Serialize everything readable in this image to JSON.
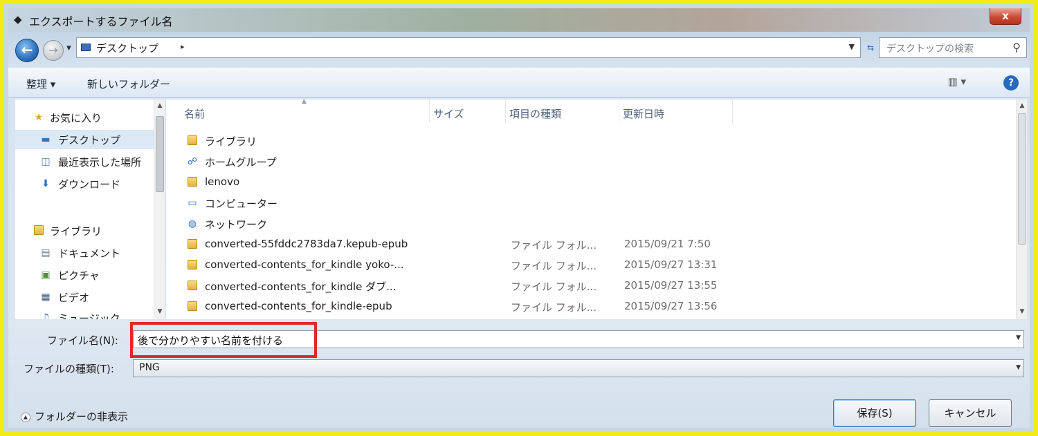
{
  "window": {
    "title": "エクスポートするファイル名",
    "close_label": "x"
  },
  "address": {
    "path": "デスクトップ",
    "separator": "▸",
    "search_placeholder": "デスクトップの検索"
  },
  "toolbar": {
    "organize_label": "整理 ▾",
    "new_folder_label": "新しいフォルダー",
    "view_label": "▥ ▾",
    "help_label": "?"
  },
  "sidebar": {
    "items": [
      {
        "label": "お気に入り",
        "icon": "star-icon"
      },
      {
        "label": "デスクトップ",
        "icon": "desktop-icon"
      },
      {
        "label": "最近表示した場所",
        "icon": "recent-places-icon"
      },
      {
        "label": "ダウンロード",
        "icon": "download-icon"
      },
      {
        "label": "ライブラリ",
        "icon": "library-icon"
      },
      {
        "label": "ドキュメント",
        "icon": "document-icon"
      },
      {
        "label": "ピクチャ",
        "icon": "picture-icon"
      },
      {
        "label": "ビデオ",
        "icon": "video-icon"
      },
      {
        "label": "ミュージック",
        "icon": "music-icon"
      }
    ]
  },
  "columns": {
    "name": "名前",
    "size": "サイズ",
    "type": "項目の種類",
    "date": "更新日時"
  },
  "files": [
    {
      "name": "ライブラリ",
      "type": "",
      "date": "",
      "icon": "library-icon"
    },
    {
      "name": "ホームグループ",
      "type": "",
      "date": "",
      "icon": "homegroup-icon"
    },
    {
      "name": "lenovo",
      "type": "",
      "date": "",
      "icon": "user-folder-icon"
    },
    {
      "name": "コンピューター",
      "type": "",
      "date": "",
      "icon": "computer-icon"
    },
    {
      "name": "ネットワーク",
      "type": "",
      "date": "",
      "icon": "network-icon"
    },
    {
      "name": "converted-55fddc2783da7.kepub-epub",
      "type": "ファイル フォル...",
      "date": "2015/09/21 7:50",
      "icon": "folder-icon"
    },
    {
      "name": "converted-contents_for_kindle yoko-...",
      "type": "ファイル フォル...",
      "date": "2015/09/27 13:31",
      "icon": "folder-icon"
    },
    {
      "name": "converted-contents_for_kindle ダブ...",
      "type": "ファイル フォル...",
      "date": "2015/09/27 13:55",
      "icon": "folder-icon"
    },
    {
      "name": "converted-contents_for_kindle-epub",
      "type": "ファイル フォル...",
      "date": "2015/09/27 13:56",
      "icon": "folder-icon"
    }
  ],
  "form": {
    "filename_label": "ファイル名(N):",
    "filename_value": "後で分かりやすい名前を付ける",
    "filetype_label": "ファイルの種類(T):",
    "filetype_value": "PNG",
    "hide_folders_label": "フォルダーの非表示",
    "save_label": "保存(S)",
    "cancel_label": "キャンセル"
  },
  "colors": {
    "frame_highlight": "#f2ea1a",
    "filename_highlight": "#e3262d",
    "accent": "#2769bd"
  }
}
